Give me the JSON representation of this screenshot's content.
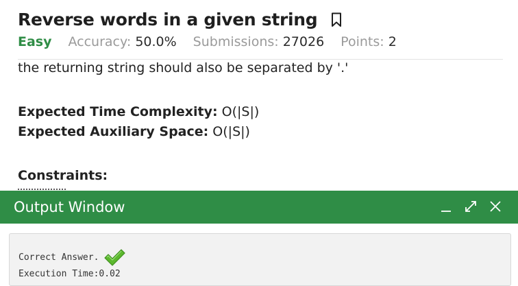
{
  "problem": {
    "title": "Reverse words in a given string",
    "difficulty": "Easy",
    "accuracy_label": "Accuracy:",
    "accuracy_value": "50.0%",
    "submissions_label": "Submissions:",
    "submissions_value": "27026",
    "points_label": "Points:",
    "points_value": "2"
  },
  "description": {
    "line1": "the returning string should also be separated by '.'",
    "time_label": "Expected Time Complexity:",
    "time_value": "O(|S|)",
    "space_label": "Expected Auxiliary Space:",
    "space_value": "O(|S|)",
    "constraints_label": "Constraints:"
  },
  "output_window": {
    "title": "Output Window",
    "result_text": "Correct Answer.",
    "execution_time": "Execution Time:0.02"
  },
  "colors": {
    "brand_green": "#2f8d46",
    "check_green": "#5cb82e"
  },
  "icons": [
    "bookmark-icon",
    "minimize-icon",
    "expand-icon",
    "close-icon",
    "checkmark-icon"
  ]
}
